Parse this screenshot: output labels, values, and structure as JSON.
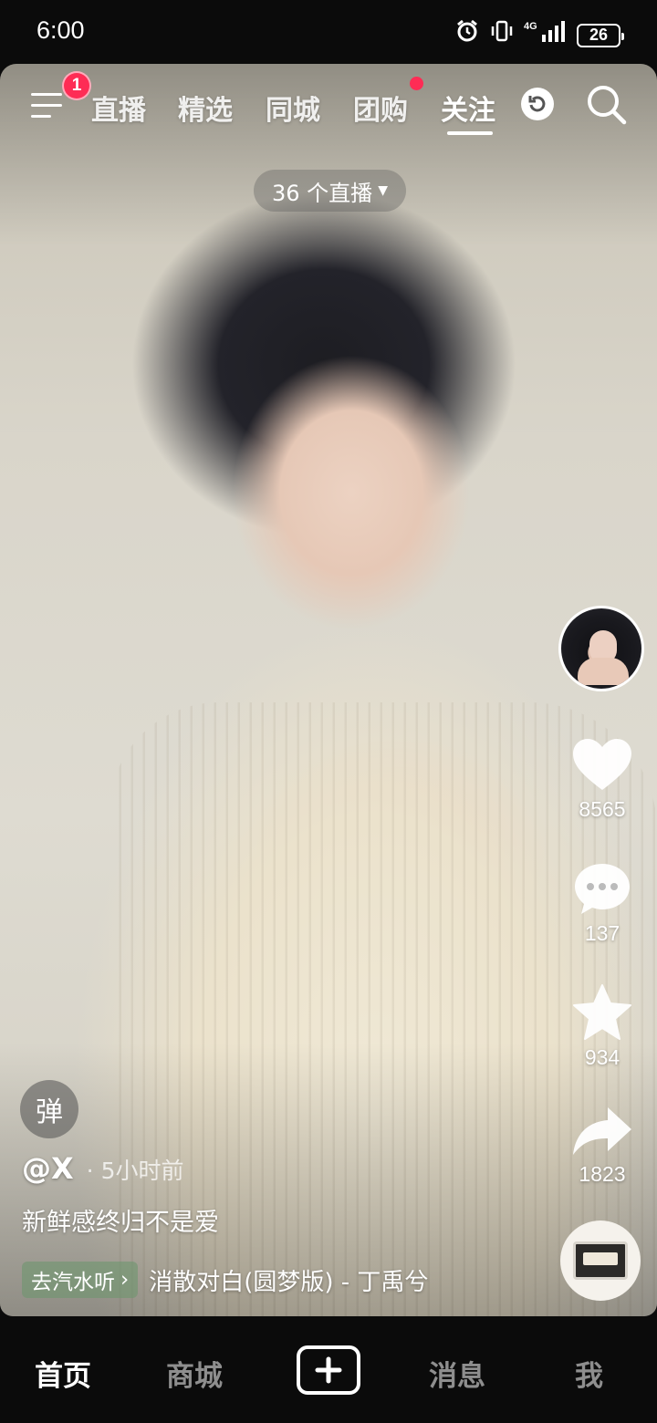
{
  "status_bar": {
    "time": "6:00",
    "network": "4G",
    "battery": "26",
    "icons": [
      "alarm-icon",
      "vibrate-icon",
      "signal-icon",
      "battery-icon"
    ]
  },
  "top_nav": {
    "menu_badge": "1",
    "tabs": [
      {
        "label": "直播",
        "active": false
      },
      {
        "label": "精选",
        "active": false
      },
      {
        "label": "同城",
        "active": false
      },
      {
        "label": "团购",
        "active": false,
        "dot": true
      },
      {
        "label": "关注",
        "active": true
      }
    ],
    "live_count_label": "36 个直播"
  },
  "rail": {
    "likes": "8565",
    "comments": "137",
    "favorites": "934",
    "shares": "1823"
  },
  "post": {
    "danmu_label": "弹",
    "author": "@X",
    "time_ago": "· 5小时前",
    "caption": "新鲜感终归不是爱",
    "music_tag": "去汽水听",
    "music_title": "消散对白(圆梦版) - 丁禹兮"
  },
  "bottom_nav": {
    "items": [
      {
        "label": "首页",
        "active": true
      },
      {
        "label": "商城",
        "active": false
      },
      {
        "label": "消息",
        "active": false
      },
      {
        "label": "我",
        "active": false
      }
    ]
  },
  "colors": {
    "accent": "#fe2c55",
    "nav_background": "#0b0b0b",
    "inactive_nav": "#8e8e8e"
  }
}
